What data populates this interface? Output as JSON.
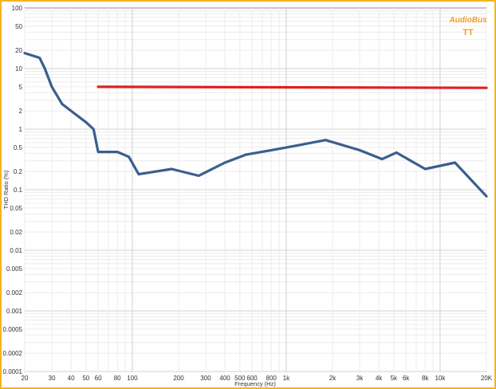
{
  "chart_data": {
    "type": "line",
    "title": "",
    "xlabel": "Frequency (Hz)",
    "ylabel": "THD Ratio (%)",
    "x_scale": "log",
    "y_scale": "log",
    "xlim": [
      20,
      20000
    ],
    "ylim": [
      0.0001,
      100
    ],
    "grid": true,
    "x_ticks": [
      {
        "value": 20,
        "label": "20"
      },
      {
        "value": 30,
        "label": "30"
      },
      {
        "value": 40,
        "label": "40"
      },
      {
        "value": 50,
        "label": "50"
      },
      {
        "value": 60,
        "label": "60"
      },
      {
        "value": 80,
        "label": "80"
      },
      {
        "value": 100,
        "label": "100"
      },
      {
        "value": 200,
        "label": "200"
      },
      {
        "value": 300,
        "label": "300"
      },
      {
        "value": 400,
        "label": "400"
      },
      {
        "value": 500,
        "label": "500"
      },
      {
        "value": 600,
        "label": "600"
      },
      {
        "value": 800,
        "label": "800"
      },
      {
        "value": 1000,
        "label": "1k"
      },
      {
        "value": 2000,
        "label": "2k"
      },
      {
        "value": 3000,
        "label": "3k"
      },
      {
        "value": 4000,
        "label": "4k"
      },
      {
        "value": 5000,
        "label": "5k"
      },
      {
        "value": 6000,
        "label": "6k"
      },
      {
        "value": 8000,
        "label": "8k"
      },
      {
        "value": 10000,
        "label": "10k"
      },
      {
        "value": 20000,
        "label": "20K"
      }
    ],
    "y_ticks": [
      {
        "value": 100,
        "label": "100"
      },
      {
        "value": 50,
        "label": "50"
      },
      {
        "value": 20,
        "label": "20"
      },
      {
        "value": 10,
        "label": "10"
      },
      {
        "value": 5,
        "label": "5"
      },
      {
        "value": 2,
        "label": "2"
      },
      {
        "value": 1,
        "label": "1"
      },
      {
        "value": 0.5,
        "label": "0.5"
      },
      {
        "value": 0.2,
        "label": "0.2"
      },
      {
        "value": 0.1,
        "label": "0.1"
      },
      {
        "value": 0.05,
        "label": "0.05"
      },
      {
        "value": 0.02,
        "label": "0.02"
      },
      {
        "value": 0.01,
        "label": "0.01"
      },
      {
        "value": 0.005,
        "label": "0.005"
      },
      {
        "value": 0.002,
        "label": "0.002"
      },
      {
        "value": 0.001,
        "label": "0.001"
      },
      {
        "value": 0.0005,
        "label": "0.0005"
      },
      {
        "value": 0.0002,
        "label": "0.0002"
      },
      {
        "value": 0.0001,
        "label": "0.0001"
      }
    ],
    "series": [
      {
        "color": "#3a5f8f",
        "x": [
          20,
          25,
          27,
          30,
          35,
          40,
          50,
          56,
          60,
          80,
          95,
          110,
          180,
          270,
          400,
          550,
          800,
          1100,
          1800,
          3000,
          4200,
          5200,
          8000,
          12500,
          20000
        ],
        "y": [
          18,
          15,
          10,
          5,
          2.6,
          2.0,
          1.3,
          1.0,
          0.42,
          0.42,
          0.35,
          0.18,
          0.22,
          0.17,
          0.28,
          0.38,
          0.45,
          0.52,
          0.66,
          0.45,
          0.32,
          0.41,
          0.22,
          0.28,
          0.078
        ]
      },
      {
        "color": "#e02020",
        "x": [
          60,
          20000
        ],
        "y": [
          5,
          4.8
        ]
      }
    ]
  },
  "brand": {
    "name": "AudioBus",
    "mark": "TT",
    "color": "#f39c2a"
  }
}
